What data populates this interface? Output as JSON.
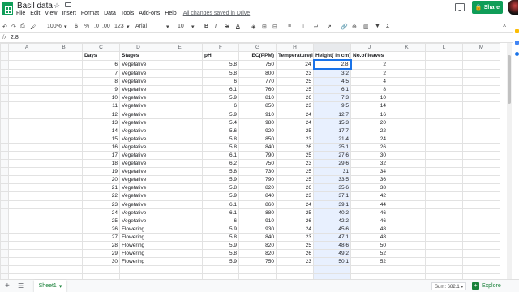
{
  "title": "Basil data",
  "menus": [
    "File",
    "Edit",
    "View",
    "Insert",
    "Format",
    "Data",
    "Tools",
    "Add-ons",
    "Help"
  ],
  "saved_status": "All changes saved in Drive",
  "share_label": "Share",
  "toolbar": {
    "zoom": "100%",
    "currency": "$",
    "percent": "%",
    "decimals_less": ".0",
    "decimals_more": ".00",
    "format": "123",
    "font": "Arial",
    "font_size": "10"
  },
  "formula_bar": {
    "fx": "fx",
    "value": "2.8"
  },
  "columns": [
    "A",
    "B",
    "C",
    "D",
    "E",
    "F",
    "G",
    "H",
    "I",
    "J",
    "K",
    "L",
    "M"
  ],
  "headers": {
    "days": "Days",
    "stages": "Stages",
    "ph": "pH",
    "ec": "EC(PPM)",
    "temp": "Temperature(in",
    "height": "Height( in cm)",
    "leaves": "No.of leaves"
  },
  "rows": [
    {
      "day": "6",
      "stage": "Vegetative",
      "ph": "5.8",
      "ec": "750",
      "temp": "24",
      "height": "2.8",
      "leaves": "2"
    },
    {
      "day": "7",
      "stage": "Vegetative",
      "ph": "5.8",
      "ec": "800",
      "temp": "23",
      "height": "3.2",
      "leaves": "2"
    },
    {
      "day": "8",
      "stage": "Vegetative",
      "ph": "6",
      "ec": "770",
      "temp": "25",
      "height": "4.5",
      "leaves": "4"
    },
    {
      "day": "9",
      "stage": "Vegetative",
      "ph": "6.1",
      "ec": "760",
      "temp": "25",
      "height": "6.1",
      "leaves": "8"
    },
    {
      "day": "10",
      "stage": "Vegetative",
      "ph": "5.9",
      "ec": "810",
      "temp": "26",
      "height": "7.3",
      "leaves": "10"
    },
    {
      "day": "11",
      "stage": "Vegetative",
      "ph": "6",
      "ec": "850",
      "temp": "23",
      "height": "9.5",
      "leaves": "14"
    },
    {
      "day": "12",
      "stage": "Vegetative",
      "ph": "5.9",
      "ec": "910",
      "temp": "24",
      "height": "12.7",
      "leaves": "16"
    },
    {
      "day": "13",
      "stage": "Vegetative",
      "ph": "5.4",
      "ec": "980",
      "temp": "24",
      "height": "15.3",
      "leaves": "20"
    },
    {
      "day": "14",
      "stage": "Vegetative",
      "ph": "5.6",
      "ec": "920",
      "temp": "25",
      "height": "17.7",
      "leaves": "22"
    },
    {
      "day": "15",
      "stage": "Vegetative",
      "ph": "5.8",
      "ec": "850",
      "temp": "23",
      "height": "21.4",
      "leaves": "24"
    },
    {
      "day": "16",
      "stage": "Vegetative",
      "ph": "5.8",
      "ec": "840",
      "temp": "26",
      "height": "25.1",
      "leaves": "26"
    },
    {
      "day": "17",
      "stage": "Vegetative",
      "ph": "6.1",
      "ec": "790",
      "temp": "25",
      "height": "27.6",
      "leaves": "30"
    },
    {
      "day": "18",
      "stage": "Vegetative",
      "ph": "6.2",
      "ec": "750",
      "temp": "23",
      "height": "29.6",
      "leaves": "32"
    },
    {
      "day": "19",
      "stage": "Vegetative",
      "ph": "5.8",
      "ec": "730",
      "temp": "25",
      "height": "31",
      "leaves": "34"
    },
    {
      "day": "20",
      "stage": "Vegetative",
      "ph": "5.9",
      "ec": "790",
      "temp": "25",
      "height": "33.5",
      "leaves": "36"
    },
    {
      "day": "21",
      "stage": "Vegetative",
      "ph": "5.8",
      "ec": "820",
      "temp": "26",
      "height": "35.6",
      "leaves": "38"
    },
    {
      "day": "22",
      "stage": "Vegetative",
      "ph": "5.9",
      "ec": "840",
      "temp": "23",
      "height": "37.1",
      "leaves": "42"
    },
    {
      "day": "23",
      "stage": "Vegetative",
      "ph": "6.1",
      "ec": "860",
      "temp": "24",
      "height": "39.1",
      "leaves": "44"
    },
    {
      "day": "24",
      "stage": "Vegetative",
      "ph": "6.1",
      "ec": "880",
      "temp": "25",
      "height": "40.2",
      "leaves": "46"
    },
    {
      "day": "25",
      "stage": "Vegetative",
      "ph": "6",
      "ec": "910",
      "temp": "26",
      "height": "42.2",
      "leaves": "46"
    },
    {
      "day": "26",
      "stage": "Flowering",
      "ph": "5.9",
      "ec": "930",
      "temp": "24",
      "height": "45.6",
      "leaves": "48"
    },
    {
      "day": "27",
      "stage": "Flowering",
      "ph": "5.8",
      "ec": "840",
      "temp": "23",
      "height": "47.1",
      "leaves": "48"
    },
    {
      "day": "28",
      "stage": "Flowering",
      "ph": "5.9",
      "ec": "820",
      "temp": "25",
      "height": "48.6",
      "leaves": "50"
    },
    {
      "day": "29",
      "stage": "Flowering",
      "ph": "5.8",
      "ec": "820",
      "temp": "26",
      "height": "49.2",
      "leaves": "52"
    },
    {
      "day": "30",
      "stage": "Flowering",
      "ph": "5.9",
      "ec": "750",
      "temp": "23",
      "height": "50.1",
      "leaves": "52"
    }
  ],
  "sheet_name": "Sheet1",
  "sum_label": "Sum: 682.1",
  "explore_label": "Explore"
}
